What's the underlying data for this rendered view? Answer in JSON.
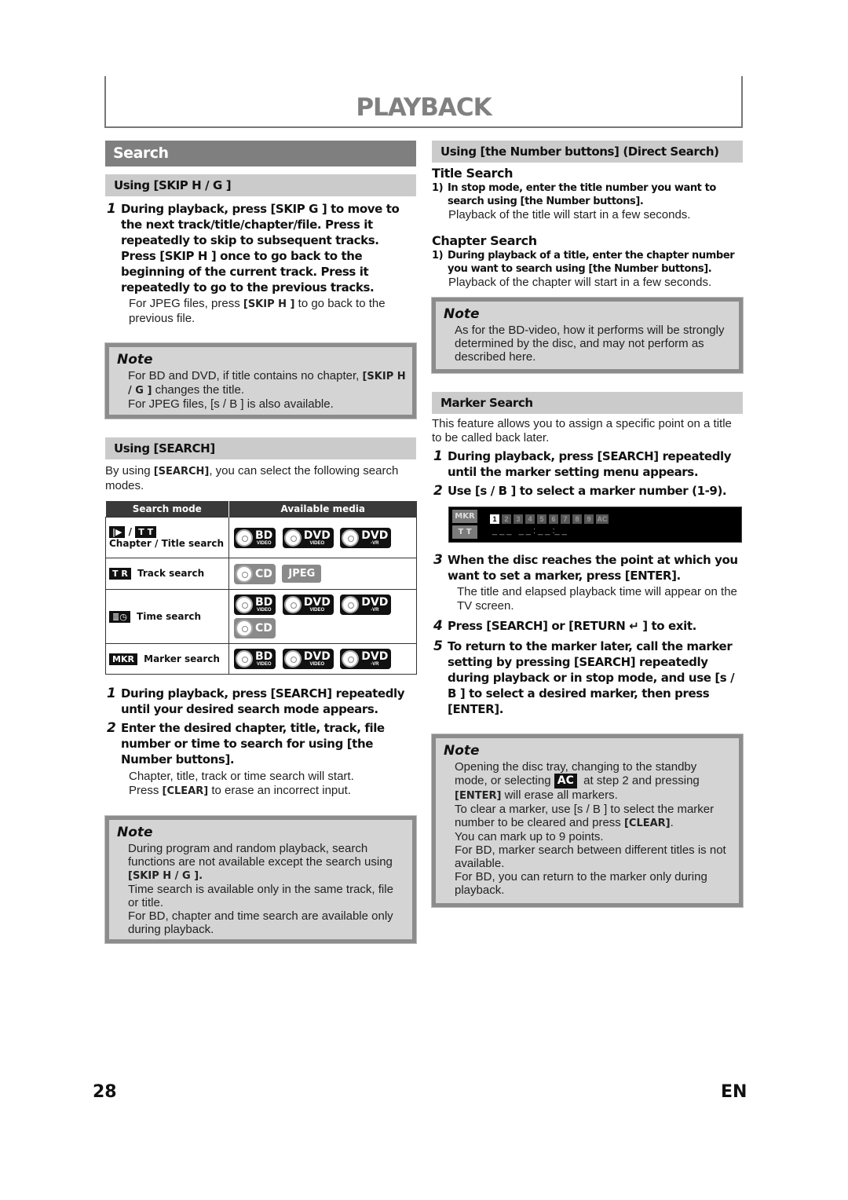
{
  "header": {
    "title": "PLAYBACK"
  },
  "left": {
    "section_title": "Search",
    "skip": {
      "heading": "Using [SKIP H / G ]",
      "step1": {
        "num": "1",
        "text": "During playback, press [SKIP G ] to move to the next track/title/chapter/file. Press it repeatedly to skip to subsequent tracks. Press [SKIP H ] once to go back to the beginning of the current track. Press it repeatedly to go to the previous tracks.",
        "sub_pre": "For JPEG files, press ",
        "sub_bold": "[SKIP H ]",
        "sub_post": " to go back to the previous file."
      }
    },
    "note1": {
      "title": "Note",
      "line1_pre": "For BD and DVD, if title contains no chapter, ",
      "line1_bold": "[SKIP H / G ]",
      "line1_post": " changes the title.",
      "line2": "For JPEG files, [s / B ] is also available."
    },
    "search": {
      "heading": "Using [SEARCH]",
      "intro_pre": "By using ",
      "intro_bold": "[SEARCH]",
      "intro_post": ", you can select the following search modes.",
      "table": {
        "headers": [
          "Search mode",
          "Available media"
        ],
        "rows": [
          {
            "icons": [
              "|▶",
              "T T"
            ],
            "sep": "/",
            "label": "Chapter / Title search",
            "media": [
              "BD|VIDEO",
              "DVD|VIDEO",
              "DVD|-VR"
            ]
          },
          {
            "icons": [
              "T R"
            ],
            "label": "Track search",
            "media": [
              "CD",
              "JPEG"
            ]
          },
          {
            "icons": [
              "≣◷"
            ],
            "label": "Time search",
            "media": [
              "BD|VIDEO",
              "DVD|VIDEO",
              "DVD|-VR",
              "CD"
            ]
          },
          {
            "icons": [
              "MKR"
            ],
            "label": "Marker search",
            "media": [
              "BD|VIDEO",
              "DVD|VIDEO",
              "DVD|-VR"
            ]
          }
        ]
      },
      "step1": {
        "num": "1",
        "text": "During playback, press [SEARCH] repeatedly until your desired search mode appears."
      },
      "step2": {
        "num": "2",
        "text": "Enter the desired chapter, title, track, file number or time to search for using [the Number buttons].",
        "sub1": "Chapter, title, track or time search will start.",
        "sub2_pre": "Press ",
        "sub2_bold": "[CLEAR]",
        "sub2_post": " to erase an incorrect input."
      }
    },
    "note2": {
      "title": "Note",
      "line1": "During program and random playback, search functions are not available except the search using",
      "line1_bold": "[SKIP H / G ].",
      "line2": "Time search is available only in the same track, file or title.",
      "line3": "For BD, chapter and time search are available only during playback."
    }
  },
  "right": {
    "direct": {
      "heading": "Using [the Number buttons] (Direct Search)",
      "title_search": {
        "heading": "Title Search",
        "num": "1)",
        "text": "In stop mode, enter the title number you want to search using [the Number buttons].",
        "sub": "Playback of the title will start in a few seconds."
      },
      "chapter_search": {
        "heading": "Chapter Search",
        "num": "1)",
        "text": "During playback of a title, enter the chapter number you want to search using [the Number buttons].",
        "sub": "Playback of the chapter will start in a few seconds."
      }
    },
    "note3": {
      "title": "Note",
      "text": "As for the BD-video, how it performs will be strongly determined by the disc, and may not perform as described here."
    },
    "marker": {
      "heading": "Marker Search",
      "intro": "This feature allows you to assign a specific point on a title to be called back later.",
      "step1": {
        "num": "1",
        "text": "During playback, press [SEARCH] repeatedly until the marker setting menu appears."
      },
      "step2": {
        "num": "2",
        "text": "Use [s / B ] to select a marker number (1-9)."
      },
      "osd": {
        "tag1": "MKR",
        "tag2": "T T",
        "markers": [
          "1",
          "2",
          "3",
          "4",
          "5",
          "6",
          "7",
          "8",
          "9",
          "AC"
        ],
        "selected": "1",
        "time": "_ _ _   _ _ : _ _ :_ _"
      },
      "step3": {
        "num": "3",
        "text": "When the disc reaches the point at which you want to set a marker, press [ENTER].",
        "sub": "The title and elapsed playback time will appear on the TV screen."
      },
      "step4": {
        "num": "4",
        "text": "Press [SEARCH] or [RETURN ↵ ] to exit."
      },
      "step5": {
        "num": "5",
        "text": "To return to the marker later, call the marker setting by pressing [SEARCH] repeatedly during playback or in stop mode, and use [s / B ] to select a desired marker, then press [ENTER]."
      }
    },
    "note4": {
      "title": "Note",
      "l1": "Opening the disc tray, changing to the standby",
      "l2_pre": "mode, or selecting ",
      "l2_badge": "AC",
      "l2_post": "  at step 2 and pressing",
      "l3_bold": "[ENTER]",
      "l3_post": " will erase all markers.",
      "l4": "To clear a marker, use [s / B ] to select the marker",
      "l5_pre": "number to be cleared and press ",
      "l5_bold": "[CLEAR]",
      "l5_post": ".",
      "l6": "You can mark up to 9 points.",
      "l7": "For BD, marker search between different titles is not available.",
      "l8": "For BD, you can return to the marker only during playback."
    }
  },
  "footer": {
    "page_number": "28",
    "language": "EN"
  }
}
